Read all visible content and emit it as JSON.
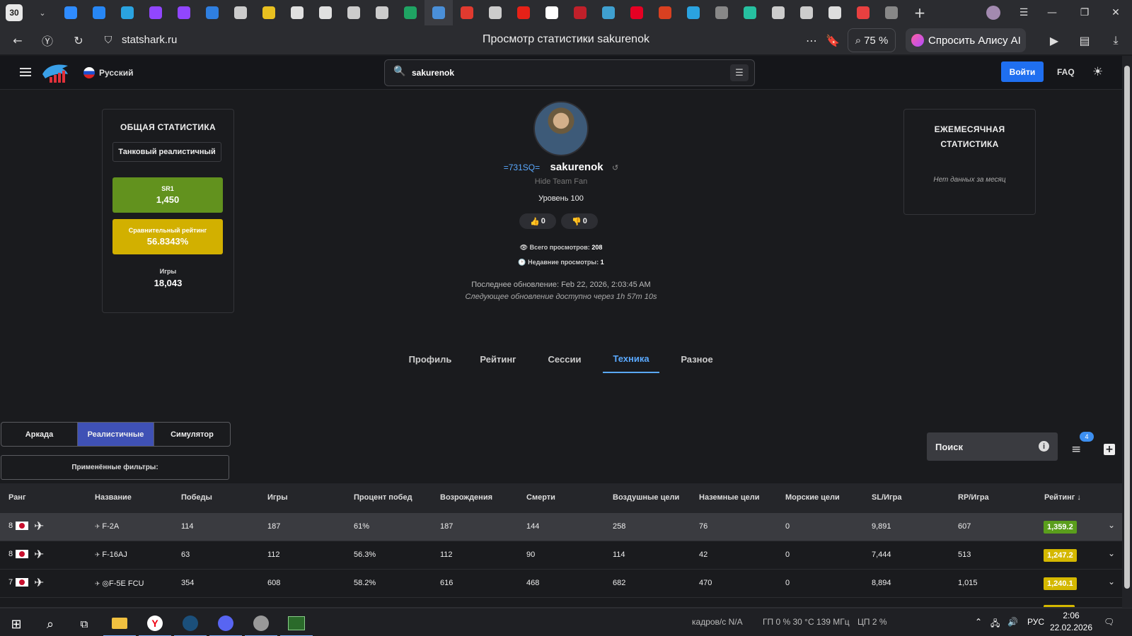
{
  "browser": {
    "tab_count": "30",
    "tabs": [
      {
        "icon": "chat-icon",
        "color": "#2f8cff"
      },
      {
        "icon": "vk-icon",
        "color": "#2787f5"
      },
      {
        "icon": "telegram-icon",
        "color": "#2aa3e0"
      },
      {
        "icon": "twitch-icon",
        "color": "#9146ff"
      },
      {
        "icon": "twitch-icon",
        "color": "#9146ff"
      },
      {
        "icon": "wing-icon",
        "color": "#2f7fe0"
      },
      {
        "icon": "diamond-icon",
        "color": "#cccccc"
      },
      {
        "icon": "coin-icon",
        "color": "#e8c020"
      },
      {
        "icon": "shield-icon",
        "color": "#e0e0e0"
      },
      {
        "icon": "shield-icon",
        "color": "#e0e0e0"
      },
      {
        "icon": "gear-icon",
        "color": "#cccccc"
      },
      {
        "icon": "tool-icon",
        "color": "#cccccc"
      },
      {
        "icon": "sheets-icon",
        "color": "#1fa463"
      },
      {
        "icon": "statshark-icon",
        "color": "#4a8fd8",
        "active": true
      },
      {
        "icon": "arrow-icon",
        "color": "#e03a2f"
      },
      {
        "icon": "badge-icon",
        "color": "#cccccc"
      },
      {
        "icon": "youtube-icon",
        "color": "#e62117"
      },
      {
        "icon": "app-icon",
        "color": "#ffffff"
      },
      {
        "icon": "game-icon",
        "color": "#c0202a"
      },
      {
        "icon": "triangle-icon",
        "color": "#3fa0d0"
      },
      {
        "icon": "pinterest-icon",
        "color": "#e60023"
      },
      {
        "icon": "game-icon",
        "color": "#d94020"
      },
      {
        "icon": "cloud-icon",
        "color": "#2aa3e0"
      },
      {
        "icon": "cloud-icon",
        "color": "#888888"
      },
      {
        "icon": "monitor-icon",
        "color": "#26c0a0"
      },
      {
        "icon": "feather-icon",
        "color": "#cccccc"
      },
      {
        "icon": "feather-icon",
        "color": "#cccccc"
      },
      {
        "icon": "stack-icon",
        "color": "#dddddd"
      },
      {
        "icon": "yandex-icon",
        "color": "#e84040"
      },
      {
        "icon": "cloud-icon",
        "color": "#888888"
      }
    ],
    "new_tab": "+",
    "domain": "statshark.ru",
    "page_title": "Просмотр статистики sakurenok",
    "zoom": "75 %",
    "alice": "Спросить Алису AI"
  },
  "site": {
    "language": "Русский",
    "search_value": "sakurenok",
    "login": "Войти",
    "faq": "FAQ"
  },
  "overall": {
    "title": "ОБЩАЯ СТАТИСТИКА",
    "mode": "Танковый реалистичный",
    "sr_label": "SR1",
    "sr_value": "1,450",
    "cmp_label": "Сравнительный рейтинг",
    "cmp_value": "56.8343%",
    "games_label": "Игры",
    "games_value": "18,043"
  },
  "monthly": {
    "title_line1": "ЕЖЕМЕСЯЧНАЯ",
    "title_line2": "СТАТИСТИКА",
    "empty": "Нет данных за месяц"
  },
  "profile": {
    "clan": "=731SQ=",
    "name": "sakurenok",
    "subtitle": "Hide Team Fan",
    "level": "Уровень 100",
    "likes": "0",
    "dislikes": "0",
    "total_views_label": "Всего просмотров:",
    "total_views": "208",
    "recent_views_label": "Недавние просмотры:",
    "recent_views": "1",
    "last_update": "Последнее обновление: Feb 22, 2026, 2:03:45 AM",
    "next_update": "Следующее обновление доступно через 1h 57m 10s"
  },
  "nav_tabs": [
    "Профиль",
    "Рейтинг",
    "Сессии",
    "Техника",
    "Разное"
  ],
  "modes": [
    "Аркада",
    "Реалистичные",
    "Симулятор"
  ],
  "applied_filters": "Применённые фильтры:",
  "table_search": "Поиск",
  "filter_count": "4",
  "columns": [
    "Ранг",
    "Название",
    "Победы",
    "Игры",
    "Процент побед",
    "Возрождения",
    "Смерти",
    "Воздушные цели",
    "Наземные цели",
    "Морские цели",
    "SL/Игра",
    "RP/Игра",
    "Рейтинг ↓"
  ],
  "rows": [
    {
      "rank": "8",
      "name": "F-2A",
      "wins": "114",
      "games": "187",
      "winrate": "61%",
      "spawns": "187",
      "deaths": "144",
      "air": "258",
      "ground": "76",
      "naval": "0",
      "sl": "9,891",
      "rp": "607",
      "rating": "1,359.2",
      "rating_color": "#5a9e1c"
    },
    {
      "rank": "8",
      "name": "F-16AJ",
      "wins": "63",
      "games": "112",
      "winrate": "56.3%",
      "spawns": "112",
      "deaths": "90",
      "air": "114",
      "ground": "42",
      "naval": "0",
      "sl": "7,444",
      "rp": "513",
      "rating": "1,247.2",
      "rating_color": "#d4b800"
    },
    {
      "rank": "7",
      "name": "◎F-5E FCU",
      "wins": "354",
      "games": "608",
      "winrate": "58.2%",
      "spawns": "616",
      "deaths": "468",
      "air": "682",
      "ground": "470",
      "naval": "0",
      "sl": "8,894",
      "rp": "1,015",
      "rating": "1,240.1",
      "rating_color": "#d4b800"
    }
  ],
  "taskbar": {
    "fps": "кадров/с  N/A",
    "gpu": "ГП  0 %  30 °C  139 МГц",
    "cpu": "ЦП  2 %",
    "lang": "РУС",
    "time": "2:06",
    "date": "22.02.2026"
  }
}
